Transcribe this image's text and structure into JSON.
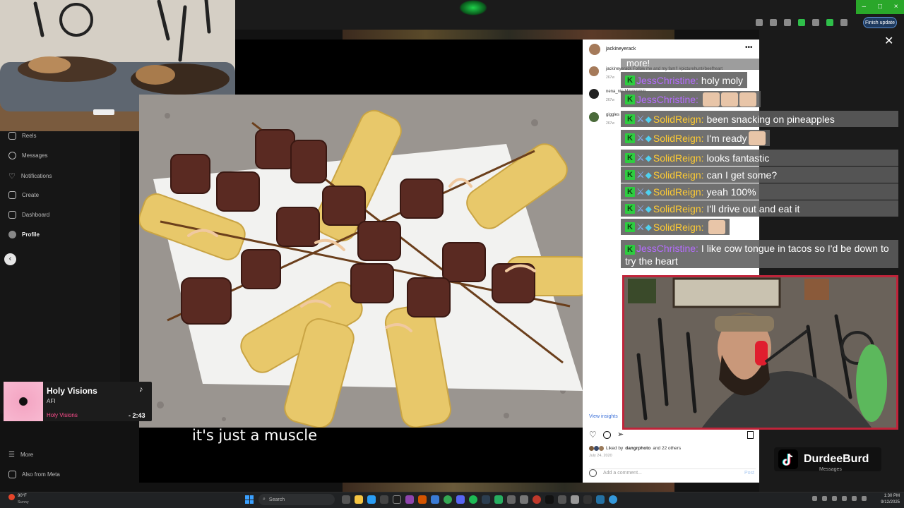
{
  "browser": {
    "finish_update": "Finish update",
    "win_min": "–",
    "win_max": "□",
    "win_close": "×"
  },
  "sidebar": {
    "items": [
      {
        "label": "Reels",
        "icon": "reels-icon"
      },
      {
        "label": "Messages",
        "icon": "messages-icon"
      },
      {
        "label": "Notifications",
        "icon": "heart-icon"
      },
      {
        "label": "Create",
        "icon": "plus-icon"
      },
      {
        "label": "Dashboard",
        "icon": "dashboard-icon"
      },
      {
        "label": "Profile",
        "icon": "avatar"
      }
    ],
    "more": "More",
    "also_from_meta": "Also from Meta"
  },
  "post": {
    "caption_overlay": "it's just a muscle",
    "username": "jackineyerack",
    "comments": [
      {
        "user": "jackineyerack",
        "text": "jackineyerack Follow me and my fam!! #picturehunt#beefheart",
        "time": "267w"
      },
      {
        "user": "nena_nip",
        "text": "nena_nip Mmmmmm",
        "time": "267w"
      },
      {
        "user": "giggles",
        "text": "giggles",
        "time": "267w"
      }
    ],
    "view_insights": "View insights",
    "liked_by": "Liked by",
    "liked_user": "dangrphoto",
    "liked_and": "and 22 others",
    "date": "July 24, 2020",
    "add_comment_placeholder": "Add a comment...",
    "post_button": "Post"
  },
  "music": {
    "title": "Holy Visions",
    "artist": "AFI",
    "album": "Holy Visions",
    "time": "- 2:43"
  },
  "chat": {
    "more_line": "more!",
    "messages": [
      {
        "user": "JessChristine",
        "text": "holy moly",
        "type": "jess"
      },
      {
        "user": "JessChristine",
        "text": "",
        "type": "jess",
        "emotes": 3
      },
      {
        "user": "SolidReign",
        "text": "been snacking on pineapples",
        "type": "solid"
      },
      {
        "user": "SolidReign",
        "text": "I'm ready",
        "type": "solid",
        "emotes": 1
      },
      {
        "user": "SolidReign",
        "text": "looks fantastic",
        "type": "solid"
      },
      {
        "user": "SolidReign",
        "text": "can I get some?",
        "type": "solid"
      },
      {
        "user": "SolidReign",
        "text": "yeah 100%",
        "type": "solid"
      },
      {
        "user": "SolidReign",
        "text": "I'll drive out and eat it",
        "type": "solid"
      },
      {
        "user": "SolidReign",
        "text": "",
        "type": "solid",
        "emotes": 1
      }
    ],
    "last": {
      "user": "JessChristine",
      "text": "I like cow tongue in tacos so I'd be down to try the heart"
    }
  },
  "stream": {
    "tiktok_name": "DurdeeBurd",
    "messages_label": "Messages"
  },
  "taskbar": {
    "weather_temp": "90°F",
    "weather_desc": "Sunny",
    "search_placeholder": "Search",
    "time": "1:30 PM",
    "date": "9/12/2025"
  },
  "colors": {
    "chat_solid": "#ffcc33",
    "chat_jess": "#b66cff",
    "cam_border": "#c0243a",
    "brand_green": "#2ecc40"
  }
}
